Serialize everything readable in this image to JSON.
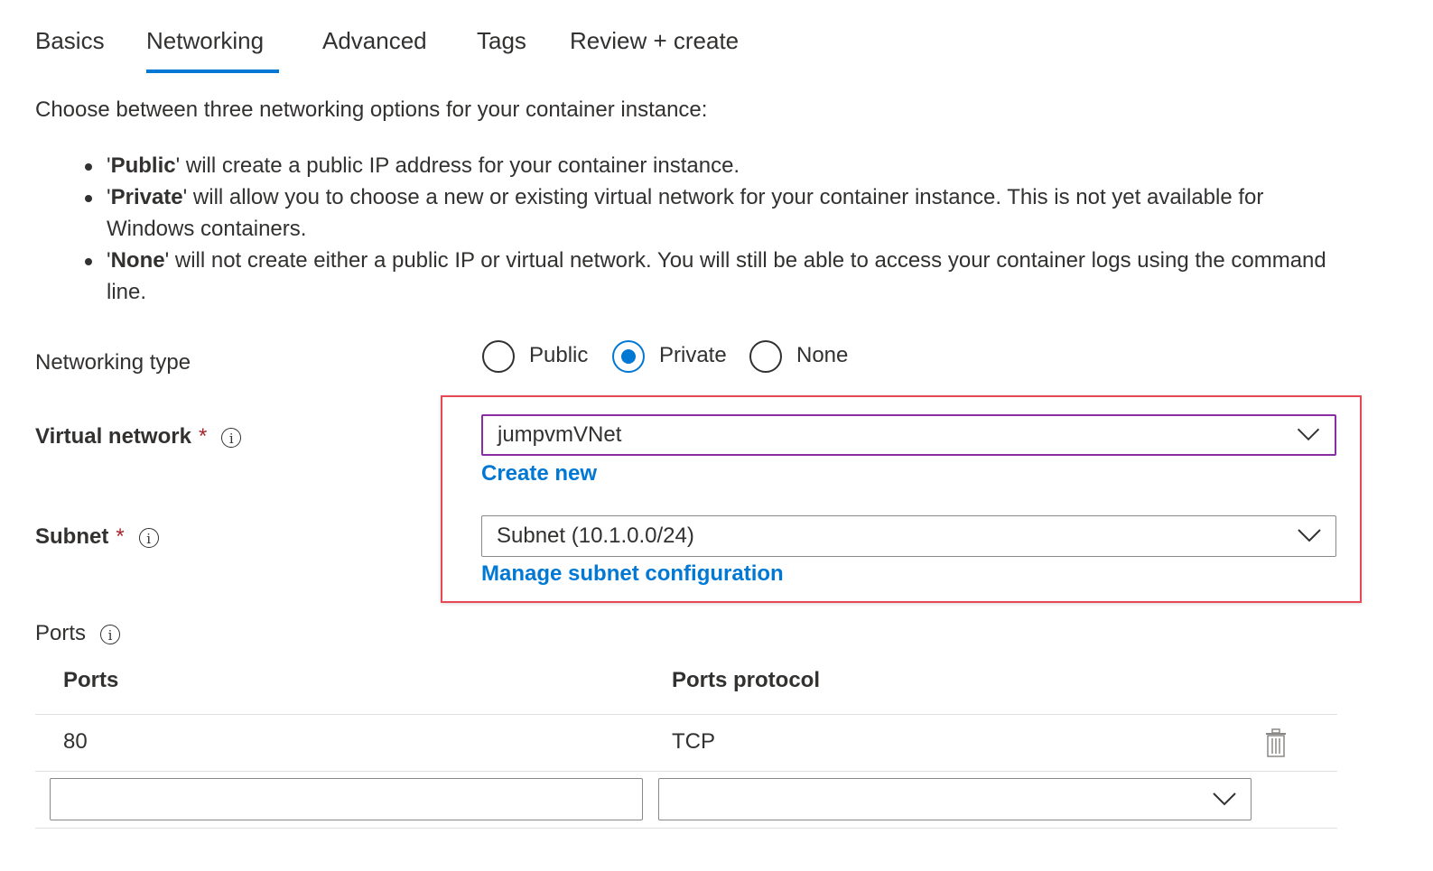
{
  "tabs": [
    {
      "label": "Basics"
    },
    {
      "label": "Networking"
    },
    {
      "label": "Advanced"
    },
    {
      "label": "Tags"
    },
    {
      "label": "Review + create"
    }
  ],
  "active_tab": "Networking",
  "intro": "Choose between three networking options for your container instance:",
  "bullets": [
    {
      "name": "Public",
      "text": " will create a public IP address for your container instance."
    },
    {
      "name": "Private",
      "text": " will allow you to choose a new or existing virtual network for your container instance. This is not yet available for Windows containers."
    },
    {
      "name": "None",
      "text": " will not create either a public IP or virtual network. You will still be able to access your container logs using the command line."
    }
  ],
  "networking_type": {
    "label": "Networking type",
    "options": [
      "Public",
      "Private",
      "None"
    ],
    "selected": "Private"
  },
  "virtual_network": {
    "label": "Virtual network",
    "required_mark": "*",
    "info_icon": "info-icon",
    "value": "jumpvmVNet",
    "link": "Create new"
  },
  "subnet": {
    "label": "Subnet",
    "required_mark": "*",
    "info_icon": "info-icon",
    "value": "Subnet (10.1.0.0/24)",
    "link": "Manage subnet configuration"
  },
  "ports": {
    "label": "Ports",
    "info_icon": "info-icon",
    "columns": [
      "Ports",
      "Ports protocol"
    ],
    "rows": [
      {
        "port": "80",
        "protocol": "TCP",
        "delete_icon": "trash-icon"
      }
    ],
    "new_port_value": "",
    "new_protocol_value": ""
  },
  "colors": {
    "accent": "#0078d4",
    "focus_border": "#8a2da5",
    "highlight_box": "#e74856",
    "required": "#a4262c"
  }
}
